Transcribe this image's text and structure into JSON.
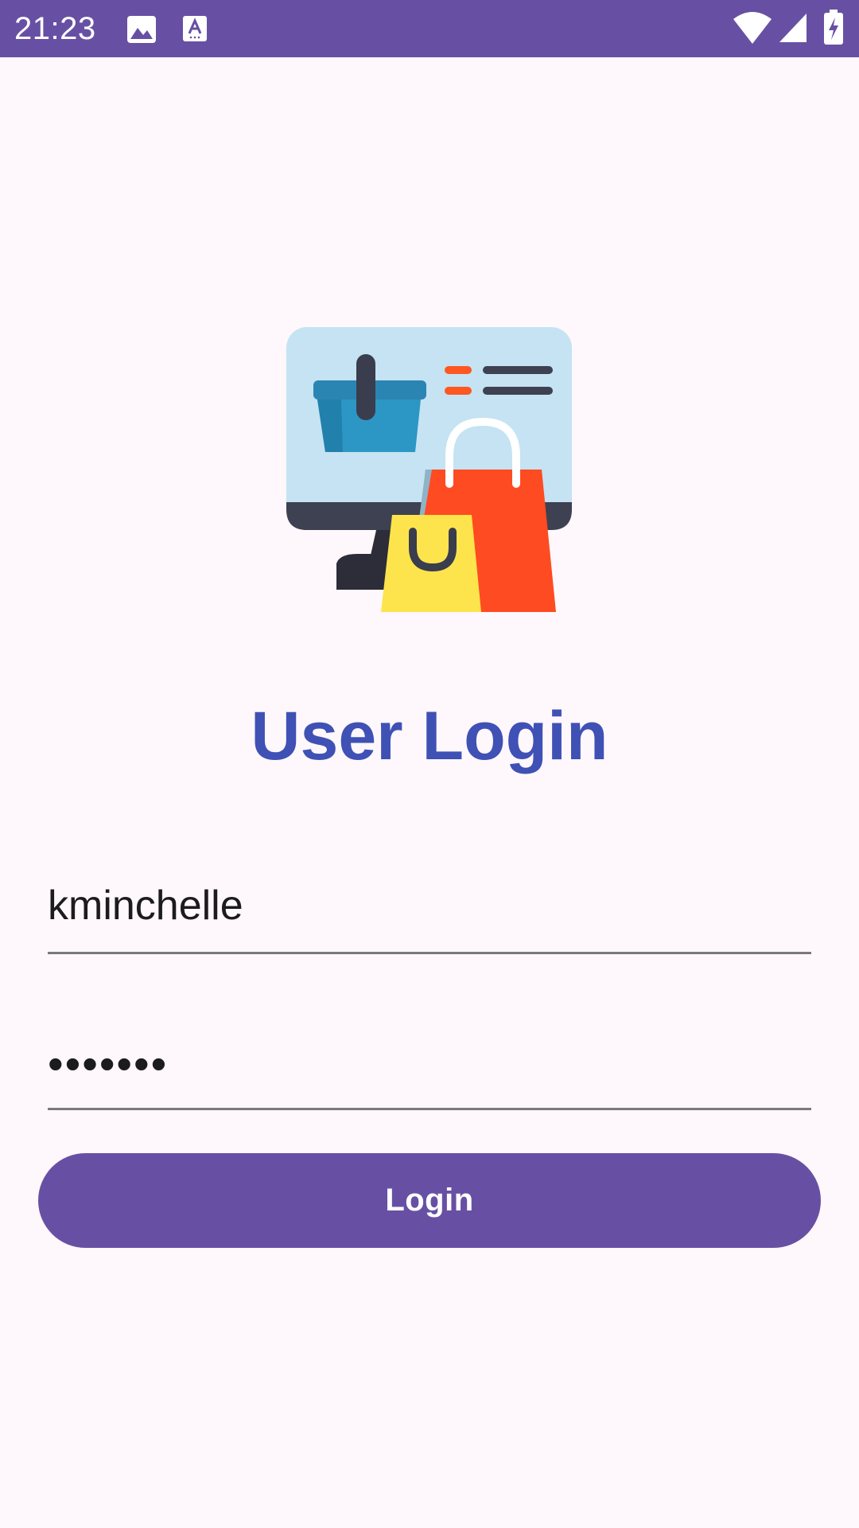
{
  "status_bar": {
    "time": "21:23",
    "icons": [
      "image-notification-icon",
      "a-notification-icon",
      "wifi-icon",
      "cellular-signal-icon",
      "battery-charging-icon"
    ],
    "background_color": "#6750a4"
  },
  "hero": {
    "icon": "online-shopping-illustration"
  },
  "page": {
    "title": "User Login",
    "title_color": "#3f51b5"
  },
  "form": {
    "username_value": "kminchelle",
    "password_value": "•••••••"
  },
  "login_button": {
    "label": "Login",
    "color": "#6750a4"
  }
}
